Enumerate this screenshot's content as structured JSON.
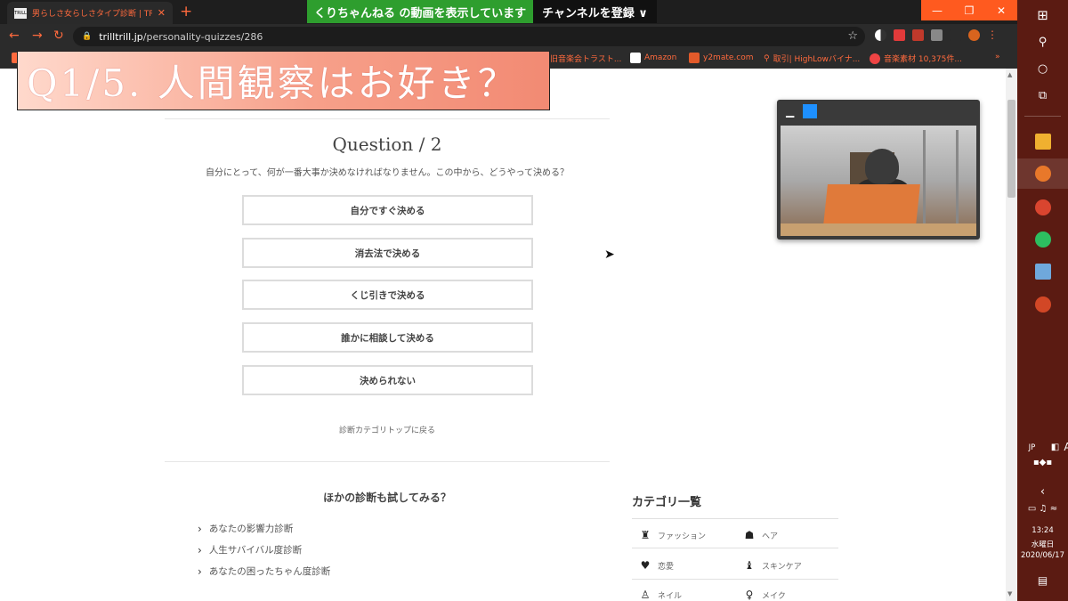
{
  "browser": {
    "tab_title": "男らしさ女らしさタイプ診断 | TRILL(",
    "tab_favicon_text": "TRILL",
    "new_tab": "+",
    "url_host": "trilltrill.jp",
    "url_path": "/personality-quizzes/286",
    "bookmarks": [
      "旧音楽会トラスト...",
      "Amazon",
      "y2mate.com",
      "取引| HighLowバイナ...",
      "音楽素材 10,375件..."
    ],
    "bookmarks_more": "»",
    "window_buttons": [
      "—",
      "❐",
      "✕"
    ]
  },
  "youtube_banner": {
    "notice": "くりちゃんねる の動画を表示しています",
    "subscribe": "チャンネルを登録 ∨"
  },
  "overlay": {
    "title": "Q1/5. 人間観察はお好き？"
  },
  "quiz": {
    "heading": "Question / 2",
    "question": "自分にとって、何が一番大事か決めなければなりません。この中から、どうやって決める？",
    "answers": [
      "自分ですぐ決める",
      "消去法で決める",
      "くじ引きで決める",
      "誰かに相談して決める",
      "決められない"
    ],
    "back_link": "診断カテゴリトップに戻る"
  },
  "others": {
    "heading": "ほかの診断も試してみる？",
    "items": [
      "あなたの影響力診断",
      "人生サバイバル度診断",
      "あなたの困ったちゃん度診断"
    ]
  },
  "categories": {
    "heading": "カテゴリ一覧",
    "items": [
      {
        "label": "ファッション",
        "icon": "dress-icon"
      },
      {
        "label": "ヘア",
        "icon": "hair-icon"
      },
      {
        "label": "恋愛",
        "icon": "heart-icon"
      },
      {
        "label": "スキンケア",
        "icon": "bottle-icon"
      },
      {
        "label": "ネイル",
        "icon": "nail-icon"
      },
      {
        "label": "メイク",
        "icon": "makeup-icon"
      }
    ]
  },
  "taskbar": {
    "lang": "JP",
    "ime": "A",
    "time": "13:24",
    "weekday": "水曜日",
    "date": "2020/06/17"
  },
  "colors": {
    "accent": "#ff6a3d",
    "taskbar": "#5b1b12",
    "banner_green": "#2e9e2e"
  }
}
